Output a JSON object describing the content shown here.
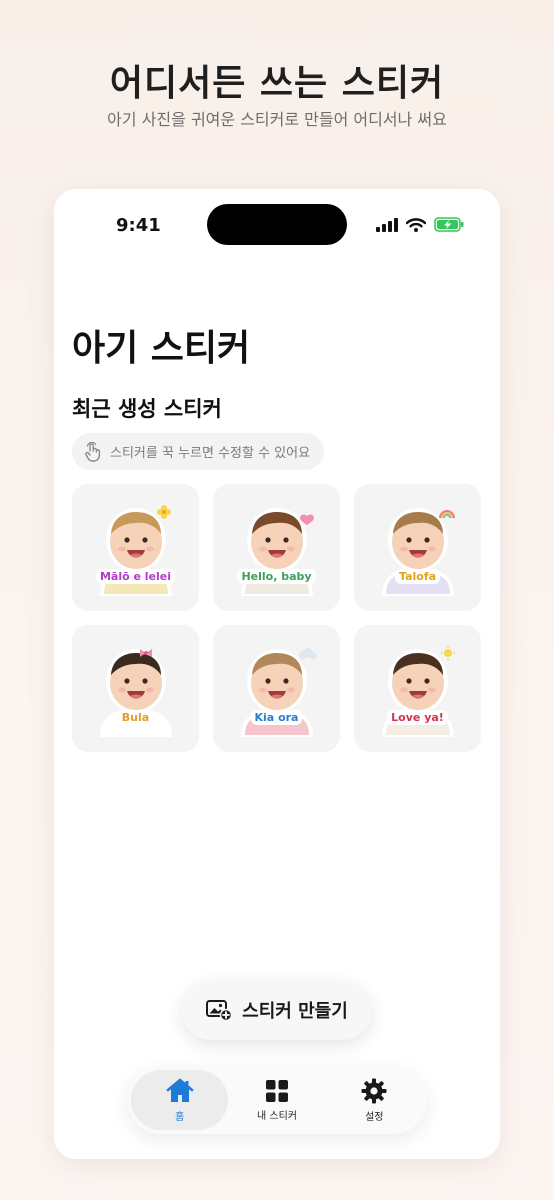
{
  "hero": {
    "title": "어디서든 쓰는 스티커",
    "subtitle": "아기 사진을 귀여운 스티커로 만들어 어디서나 써요"
  },
  "status_bar": {
    "time": "9:41",
    "icons": [
      "signal-bars-icon",
      "wifi-icon",
      "battery-charging-icon"
    ],
    "battery_color": "#34c759"
  },
  "app": {
    "title": "아기 스티커",
    "section_title": "최근 생성 스티커",
    "hint": "스티커를 꾹 누르면 수정할 수 있어요",
    "hint_icon": "tap-hand-icon"
  },
  "stickers": [
    {
      "caption": "Mālō e lelei",
      "caption_color": "#b33cc8",
      "shirt": "#f5e7b8",
      "hair": "#c89a5a",
      "accent": "flower"
    },
    {
      "caption": "Hello, baby",
      "caption_color": "#3aa05a",
      "shirt": "#efeae0",
      "hair": "#7a4a2a",
      "accent": "heart"
    },
    {
      "caption": "Talofa",
      "caption_color": "#e0a31a",
      "shirt": "#e6e0f5",
      "hair": "#a87b4a",
      "accent": "rainbow"
    },
    {
      "caption": "Bula",
      "caption_color": "#e89a2a",
      "shirt": "#ffffff",
      "hair": "#3a2a20",
      "accent": "bow"
    },
    {
      "caption": "Kia ora",
      "caption_color": "#2a7fd0",
      "shirt": "#f5c4cc",
      "hair": "#b0885a",
      "accent": "cloud"
    },
    {
      "caption": "Love ya!",
      "caption_color": "#d8334a",
      "shirt": "#f3ede4",
      "hair": "#4a3020",
      "accent": "sun"
    }
  ],
  "create_button": {
    "label": "스티커 만들기",
    "icon": "add-photo-icon"
  },
  "tabbar": {
    "items": [
      {
        "label": "홈",
        "icon": "home-icon",
        "active": true
      },
      {
        "label": "내 스티커",
        "icon": "grid-icon",
        "active": false
      },
      {
        "label": "설정",
        "icon": "gear-icon",
        "active": false
      }
    ],
    "active_color": "#1e7ad8"
  }
}
